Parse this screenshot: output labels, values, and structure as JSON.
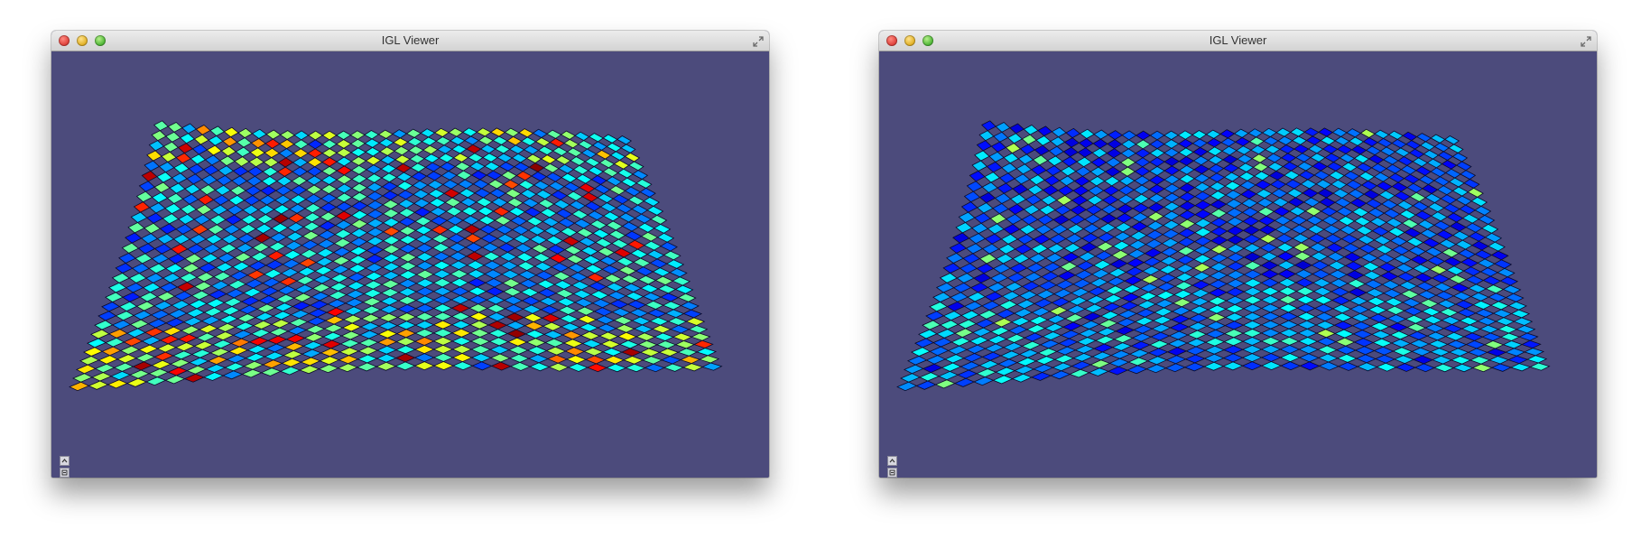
{
  "windows": [
    {
      "id": "left",
      "title": "IGL Viewer",
      "field_variant": "hot",
      "colors": {
        "background": "#4c4b7c",
        "colormap": "jet"
      }
    },
    {
      "id": "right",
      "title": "IGL Viewer",
      "field_variant": "cool",
      "colors": {
        "background": "#4c4b7c",
        "colormap": "jet"
      }
    }
  ],
  "icons": {
    "close": "close-icon",
    "minimize": "minimize-icon",
    "zoom": "zoom-icon",
    "fullscreen": "fullscreen-icon",
    "collapse": "chevron-up-icon",
    "settings": "settings-icon"
  }
}
